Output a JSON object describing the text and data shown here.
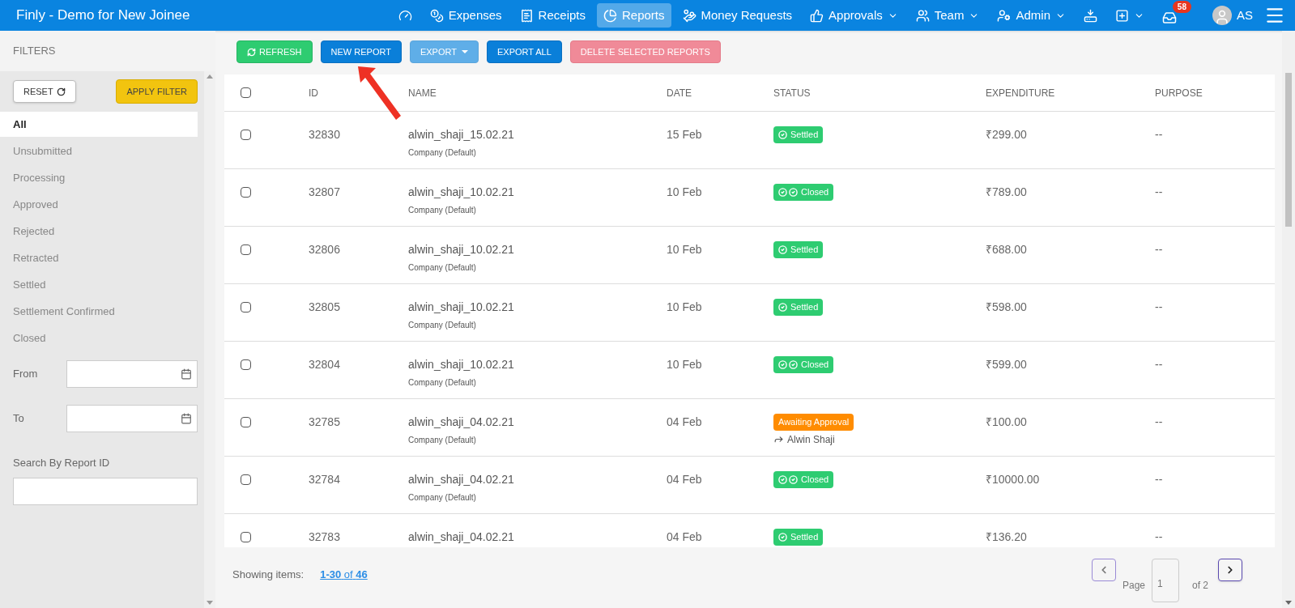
{
  "app_title": "Finly - Demo for New Joinee",
  "nav": [
    {
      "kind": "dashboard",
      "selected": false,
      "dropdown": false
    },
    {
      "kind": "expenses",
      "label": "Expenses",
      "selected": false,
      "dropdown": false
    },
    {
      "kind": "receipts",
      "label": "Receipts",
      "selected": false,
      "dropdown": false
    },
    {
      "kind": "reports",
      "label": "Reports",
      "selected": true,
      "dropdown": false
    },
    {
      "kind": "money",
      "label": "Money Requests",
      "selected": false,
      "dropdown": false
    },
    {
      "kind": "approvals",
      "label": "Approvals",
      "selected": false,
      "dropdown": true
    },
    {
      "kind": "team",
      "label": "Team",
      "selected": false,
      "dropdown": true
    },
    {
      "kind": "admin",
      "label": "Admin",
      "selected": false,
      "dropdown": true
    },
    {
      "kind": "download",
      "selected": false,
      "dropdown": false
    },
    {
      "kind": "add",
      "selected": false,
      "dropdown": true
    }
  ],
  "inbox_badge": "58",
  "user_initials": "AS",
  "sidebar": {
    "title": "FILTERS",
    "reset": "RESET",
    "apply": "APPLY FILTER",
    "filters": [
      {
        "label": "All",
        "selected": true
      },
      {
        "label": "Unsubmitted",
        "selected": false
      },
      {
        "label": "Processing",
        "selected": false
      },
      {
        "label": "Approved",
        "selected": false
      },
      {
        "label": "Rejected",
        "selected": false
      },
      {
        "label": "Retracted",
        "selected": false
      },
      {
        "label": "Settled",
        "selected": false
      },
      {
        "label": "Settlement Confirmed",
        "selected": false
      },
      {
        "label": "Closed",
        "selected": false
      }
    ],
    "from_label": "From",
    "to_label": "To",
    "search_label": "Search By Report ID"
  },
  "toolbar": [
    {
      "kind": "refresh",
      "label": "REFRESH"
    },
    {
      "kind": "primary",
      "label": "NEW REPORT"
    },
    {
      "kind": "export",
      "label": "EXPORT"
    },
    {
      "kind": "primary",
      "label": "EXPORT ALL"
    },
    {
      "kind": "danger",
      "label": "DELETE SELECTED REPORTS"
    }
  ],
  "table": {
    "columns": [
      "ID",
      "NAME",
      "DATE",
      "STATUS",
      "EXPENDITURE",
      "PURPOSE"
    ],
    "all_checked": false,
    "rows": [
      {
        "checked": false,
        "id": "32830",
        "name": "alwin_shaji_15.02.21",
        "company": "Company (Default)",
        "date": "15 Feb",
        "status": {
          "kind": "settled",
          "label": "Settled"
        },
        "expenditure": "₹299.00",
        "purpose": "--"
      },
      {
        "checked": false,
        "id": "32807",
        "name": "alwin_shaji_10.02.21",
        "company": "Company (Default)",
        "date": "10 Feb",
        "status": {
          "kind": "closed",
          "label": "Closed"
        },
        "expenditure": "₹789.00",
        "purpose": "--"
      },
      {
        "checked": false,
        "id": "32806",
        "name": "alwin_shaji_10.02.21",
        "company": "Company (Default)",
        "date": "10 Feb",
        "status": {
          "kind": "settled",
          "label": "Settled"
        },
        "expenditure": "₹688.00",
        "purpose": "--"
      },
      {
        "checked": false,
        "id": "32805",
        "name": "alwin_shaji_10.02.21",
        "company": "Company (Default)",
        "date": "10 Feb",
        "status": {
          "kind": "settled",
          "label": "Settled"
        },
        "expenditure": "₹598.00",
        "purpose": "--"
      },
      {
        "checked": false,
        "id": "32804",
        "name": "alwin_shaji_10.02.21",
        "company": "Company (Default)",
        "date": "10 Feb",
        "status": {
          "kind": "closed",
          "label": "Closed"
        },
        "expenditure": "₹599.00",
        "purpose": "--"
      },
      {
        "checked": false,
        "id": "32785",
        "name": "alwin_shaji_04.02.21",
        "company": "Company (Default)",
        "date": "04 Feb",
        "status": {
          "kind": "awaiting",
          "label": "Awaiting Approval",
          "assignee": "Alwin Shaji"
        },
        "expenditure": "₹100.00",
        "purpose": "--"
      },
      {
        "checked": false,
        "id": "32784",
        "name": "alwin_shaji_04.02.21",
        "company": "Company (Default)",
        "date": "04 Feb",
        "status": {
          "kind": "closed",
          "label": "Closed"
        },
        "expenditure": "₹10000.00",
        "purpose": "--"
      },
      {
        "checked": false,
        "id": "32783",
        "name": "alwin_shaji_04.02.21",
        "date": "04 Feb",
        "status": {
          "kind": "settled",
          "label": "Settled"
        },
        "expenditure": "₹136.20",
        "purpose": "--"
      }
    ]
  },
  "footer": {
    "showing_label": "Showing items:",
    "range": "1-30",
    "of_word": "of",
    "total": "46",
    "page_label": "Page",
    "page_value": "1",
    "page_of": "of 2"
  }
}
